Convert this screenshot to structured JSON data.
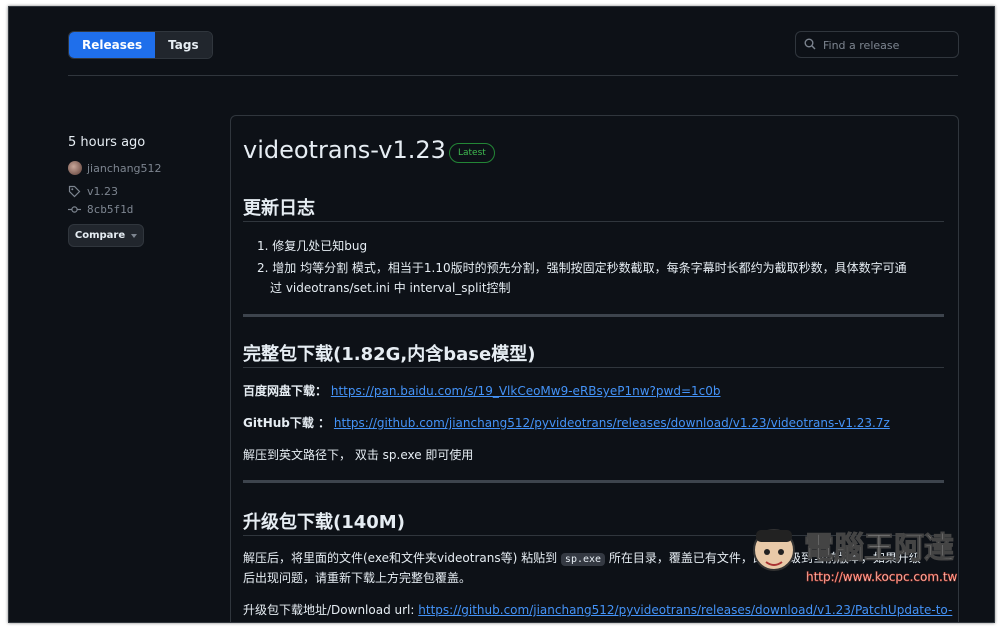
{
  "nav": {
    "tabs": [
      "Releases",
      "Tags"
    ],
    "search_placeholder": "Find a release"
  },
  "sidebar": {
    "time": "5 hours ago",
    "author": "jianchang512",
    "tag": "v1.23",
    "commit": "8cb5f1d",
    "compare_label": "Compare"
  },
  "release": {
    "title": "videotrans-v1.23",
    "badge": "Latest",
    "changelog_heading": "更新日志",
    "changelog": [
      "1. 修复几处已知bug",
      "2. 增加 均等分割 模式，相当于1.10版时的预先分割，强制按固定秒数截取，每条字幕时长都约为截取秒数，具体数字可通",
      "过 videotrans/set.ini 中 interval_split控制"
    ],
    "full_heading": "完整包下载(1.82G,内含base模型)",
    "baidu_label": "百度网盘下载：",
    "baidu_url": "https://pan.baidu.com/s/19_VlkCeoMw9-eRBsyeP1nw?pwd=1c0b",
    "github_label": "GitHub下载 ：",
    "github_url": "https://github.com/jianchang512/pyvideotrans/releases/download/v1.23/videotrans-v1.23.7z",
    "extract_note": "解压到英文路径下， 双击 sp.exe 即可使用",
    "upgrade_heading": "升级包下载(140M)",
    "upgrade_text_a": "解压后，将里面的文件(exe和文件夹videotrans等) 粘贴到",
    "upgrade_code": "sp.exe",
    "upgrade_text_b": "所在目录，覆盖已有文件，即可升级到当前版本，如果升级",
    "upgrade_text_c": "后出现问题，请重新下载上方完整包覆盖。",
    "upgrade_url_label": "升级包下载地址/Download url:",
    "upgrade_url": "https://github.com/jianchang512/pyvideotrans/releases/download/v1.23/PatchUpdate-to-"
  },
  "watermark": {
    "text": "電腦王阿達",
    "url": "http://www.kocpc.com.tw"
  },
  "colors": {
    "accent": "#1f6feb",
    "link": "#4493f8",
    "latest": "#3fb950",
    "background": "#0d1117"
  }
}
